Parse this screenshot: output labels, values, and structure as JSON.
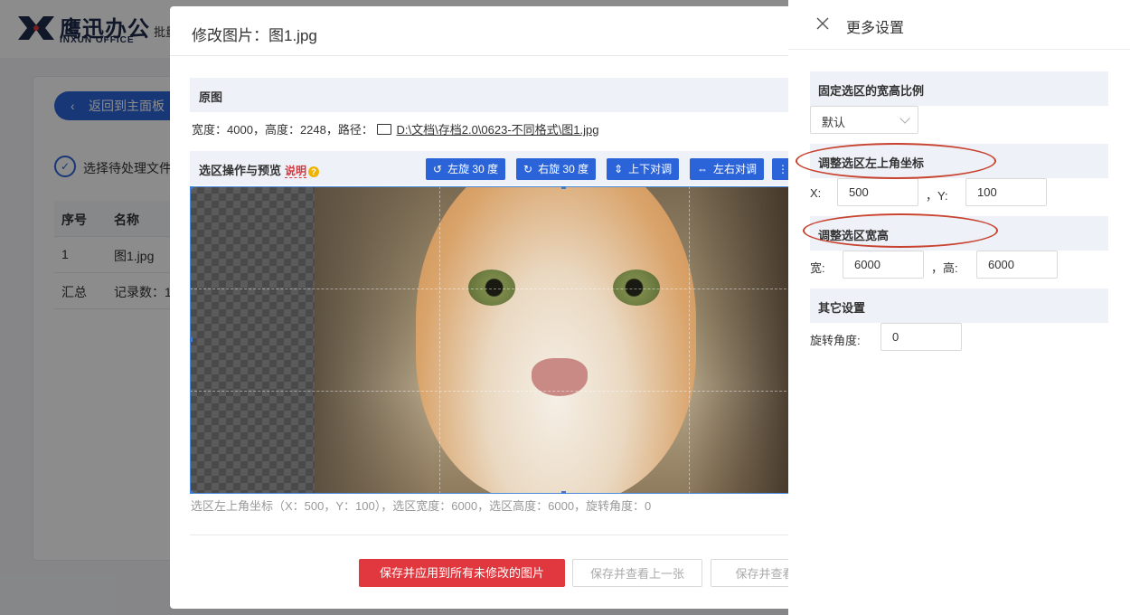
{
  "app": {
    "brand_cn": "鹰迅办公",
    "brand_en": "INXUN OFFICE",
    "header_tab": "批量",
    "back_button": "返回到主面板",
    "step_label": "选择待处理文件",
    "table": {
      "headers": [
        "序号",
        "名称"
      ],
      "rows": [
        [
          "1",
          "图1.jpg"
        ],
        [
          "汇总",
          "记录数：1"
        ]
      ]
    }
  },
  "modal": {
    "title": "修改图片：图1.jpg",
    "original_section": "原图",
    "width_label": "宽度：",
    "width_value": "4000",
    "height_label": "，高度：",
    "height_value": "2248",
    "path_label": "，路径：",
    "path_value": "D:\\文档\\存档2.0\\0623-不同格式\\图1.jpg",
    "preview_section": "选区操作与预览",
    "help_link": "说明",
    "tools": [
      {
        "label": "左旋 30 度",
        "icon": "rotate-left-icon",
        "glyph": "↺"
      },
      {
        "label": "右旋 30 度",
        "icon": "rotate-right-icon",
        "glyph": "↻"
      },
      {
        "label": "上下对调",
        "icon": "flip-vertical-icon",
        "glyph": "⇕"
      },
      {
        "label": "左右对调",
        "icon": "flip-horizontal-icon",
        "glyph": "⇔"
      }
    ],
    "status_line": "选区左上角坐标（X：500，Y：100），选区宽度：6000，选区高度：6000，旋转角度：0",
    "buttons": {
      "apply_all": "保存并应用到所有未修改的图片",
      "save_prev": "保存并查看上一张",
      "save_next": "保存并查看"
    }
  },
  "drawer": {
    "title": "更多设置",
    "ratio_section": "固定选区的宽高比例",
    "ratio_value": "默认",
    "coord_section": "调整选区左上角坐标",
    "x_label": "X:",
    "x_value": "500",
    "y_label": "，Y:",
    "y_value": "100",
    "size_section": "调整选区宽高",
    "w_label": "宽:",
    "w_value": "6000",
    "h_label": "，高:",
    "h_value": "6000",
    "other_section": "其它设置",
    "rotate_label": "旋转角度:",
    "rotate_value": "0"
  },
  "colors": {
    "primary": "#2b64d9",
    "danger": "#e0383e",
    "annotation": "#c8432f"
  }
}
